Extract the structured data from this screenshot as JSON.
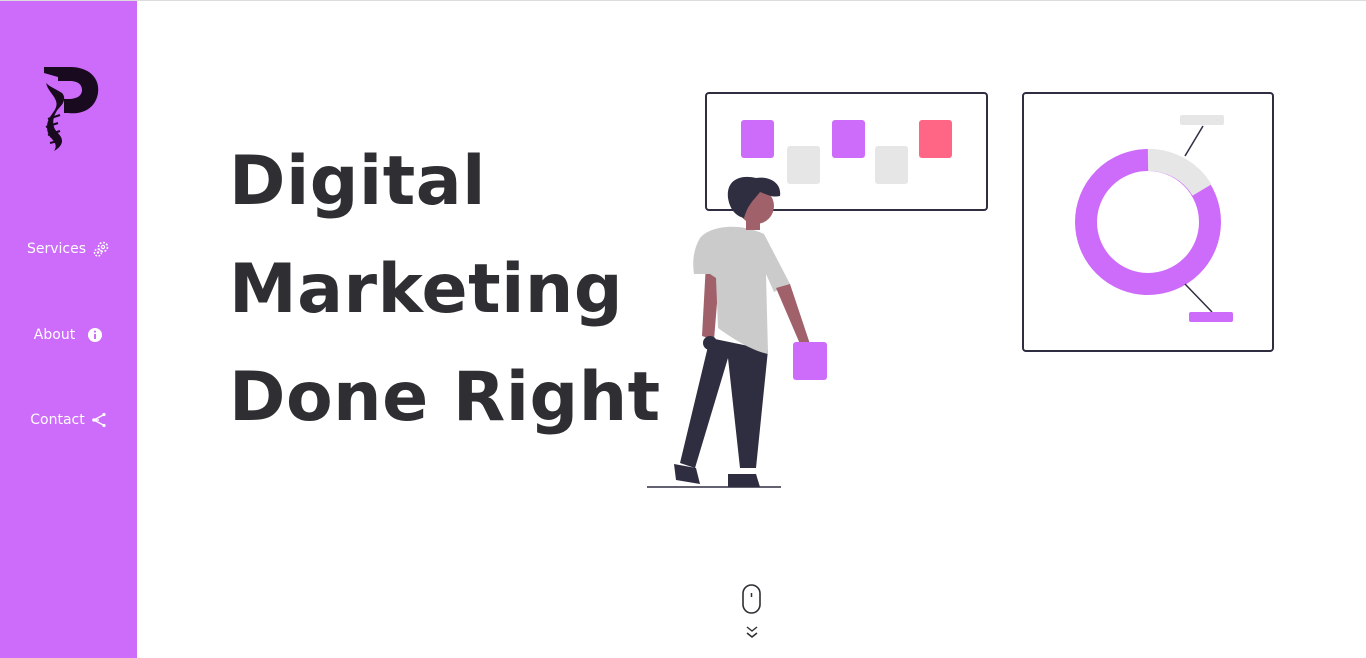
{
  "brand": {
    "logo": "p-brush-logo",
    "accent_color": "#cd6bfa",
    "highlight_color": "#ff6584",
    "text_color": "#2f2e33"
  },
  "sidebar": {
    "items": [
      {
        "label": "Services",
        "icon": "gears-icon"
      },
      {
        "label": "About",
        "icon": "info-icon"
      },
      {
        "label": "Contact",
        "icon": "share-icon"
      }
    ]
  },
  "hero": {
    "lines": [
      "Digital",
      "Marketing",
      "Done Right"
    ]
  },
  "scroll_hint": {
    "icon": "mouse-icon",
    "arrow": "double-chevron-down-icon"
  }
}
